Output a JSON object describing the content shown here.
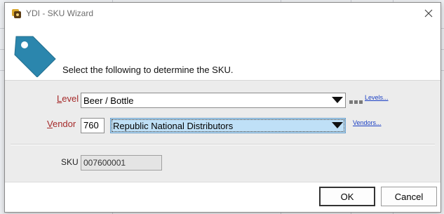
{
  "window": {
    "title": "YDI - SKU Wizard",
    "icon": "wizard-app-icon",
    "close_icon": "close-icon"
  },
  "header": {
    "icon": "price-tag-icon",
    "instruction": "Select the following to determine the SKU.",
    "accent_color": "#2b86ad"
  },
  "form": {
    "level": {
      "label_first": "L",
      "label_rest": "evel",
      "value": "Beer / Bottle",
      "link": "Levels..."
    },
    "vendor": {
      "label_first": "V",
      "label_rest": "endor",
      "code": "760",
      "name": "Republic National Distributors",
      "link": "Vendors..."
    },
    "sku": {
      "label": "SKU",
      "value": "007600001"
    }
  },
  "footer": {
    "ok_label": "OK",
    "cancel_label": "Cancel"
  },
  "colors": {
    "label_red": "#a52a2a",
    "selected_fill": "#bfe0f7",
    "link_blue": "#1a3fc4"
  }
}
